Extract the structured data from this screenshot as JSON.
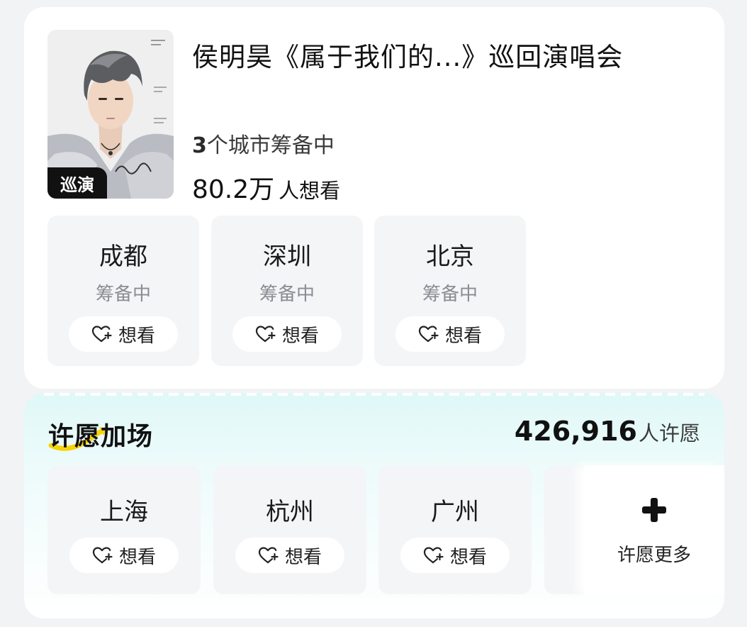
{
  "tour": {
    "title": "侯明昊《属于我们的...》巡回演唱会",
    "badge": "巡演",
    "city_count_num": "3",
    "city_count_text": "个城市筹备中",
    "want_count": "80.2万",
    "want_label": "人想看",
    "poster_icon": "artist-poster-image"
  },
  "cities": [
    {
      "name": "成都",
      "status": "筹备中",
      "button": "想看"
    },
    {
      "name": "深圳",
      "status": "筹备中",
      "button": "想看"
    },
    {
      "name": "北京",
      "status": "筹备中",
      "button": "想看"
    }
  ],
  "wish": {
    "title": "许愿加场",
    "count": "426,916",
    "count_label": "人许愿",
    "cities": [
      {
        "name": "上海",
        "button": "想看"
      },
      {
        "name": "杭州",
        "button": "想看"
      },
      {
        "name": "广州",
        "button": "想看"
      }
    ],
    "more_label": "许愿更多",
    "accent": "#f5d40a"
  },
  "colors": {
    "page_bg": "#f2f3f5",
    "card_bg": "#ffffff",
    "city_card_bg": "#f4f5f7",
    "wish_gradient_top": "#dff8f7",
    "badge_bg": "#111111"
  }
}
